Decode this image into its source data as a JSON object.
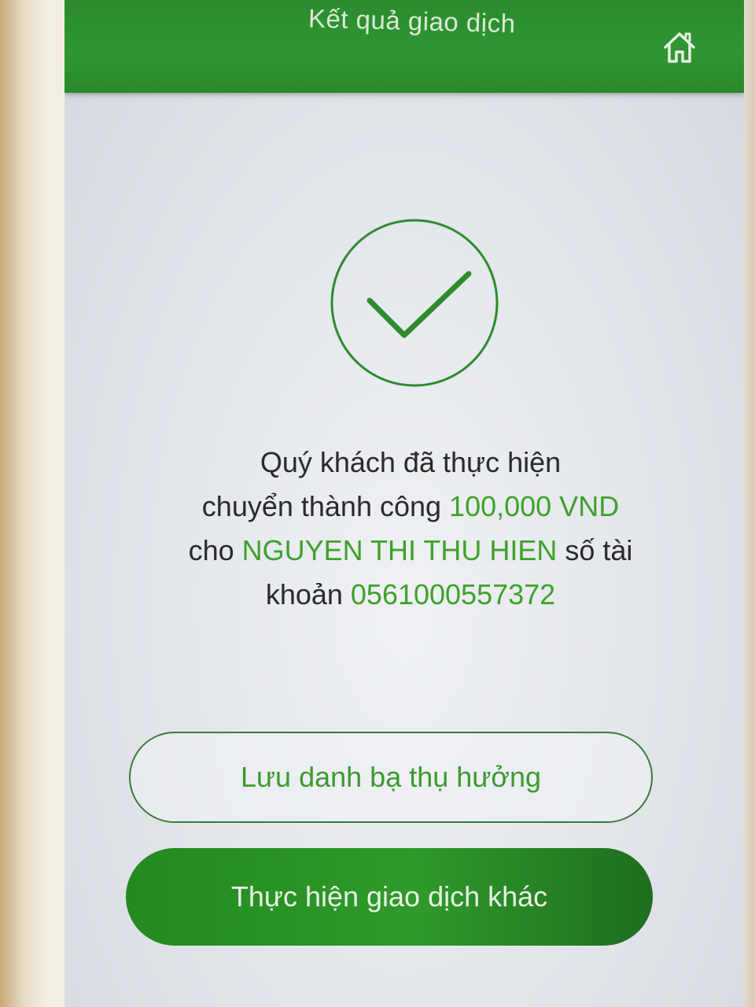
{
  "header": {
    "title": "Kết quả giao dịch",
    "home_icon": "home-icon"
  },
  "result": {
    "status_icon": "checkmark-circle-icon",
    "message_line1": "Quý khách đã thực hiện",
    "message_prefix2": "chuyển thành công ",
    "amount": "100,000 VND",
    "message_prefix3": "cho ",
    "recipient_name": "NGUYEN THI THU HIEN",
    "message_mid3": " số tài",
    "message_prefix4": "khoản ",
    "account_number": "0561000557372"
  },
  "actions": {
    "save_beneficiary_label": "Lưu danh bạ thụ hưởng",
    "new_transaction_label": "Thực hiện giao dịch khác"
  },
  "colors": {
    "brand_green": "#2f9632",
    "highlight_green": "#3fa12b"
  }
}
